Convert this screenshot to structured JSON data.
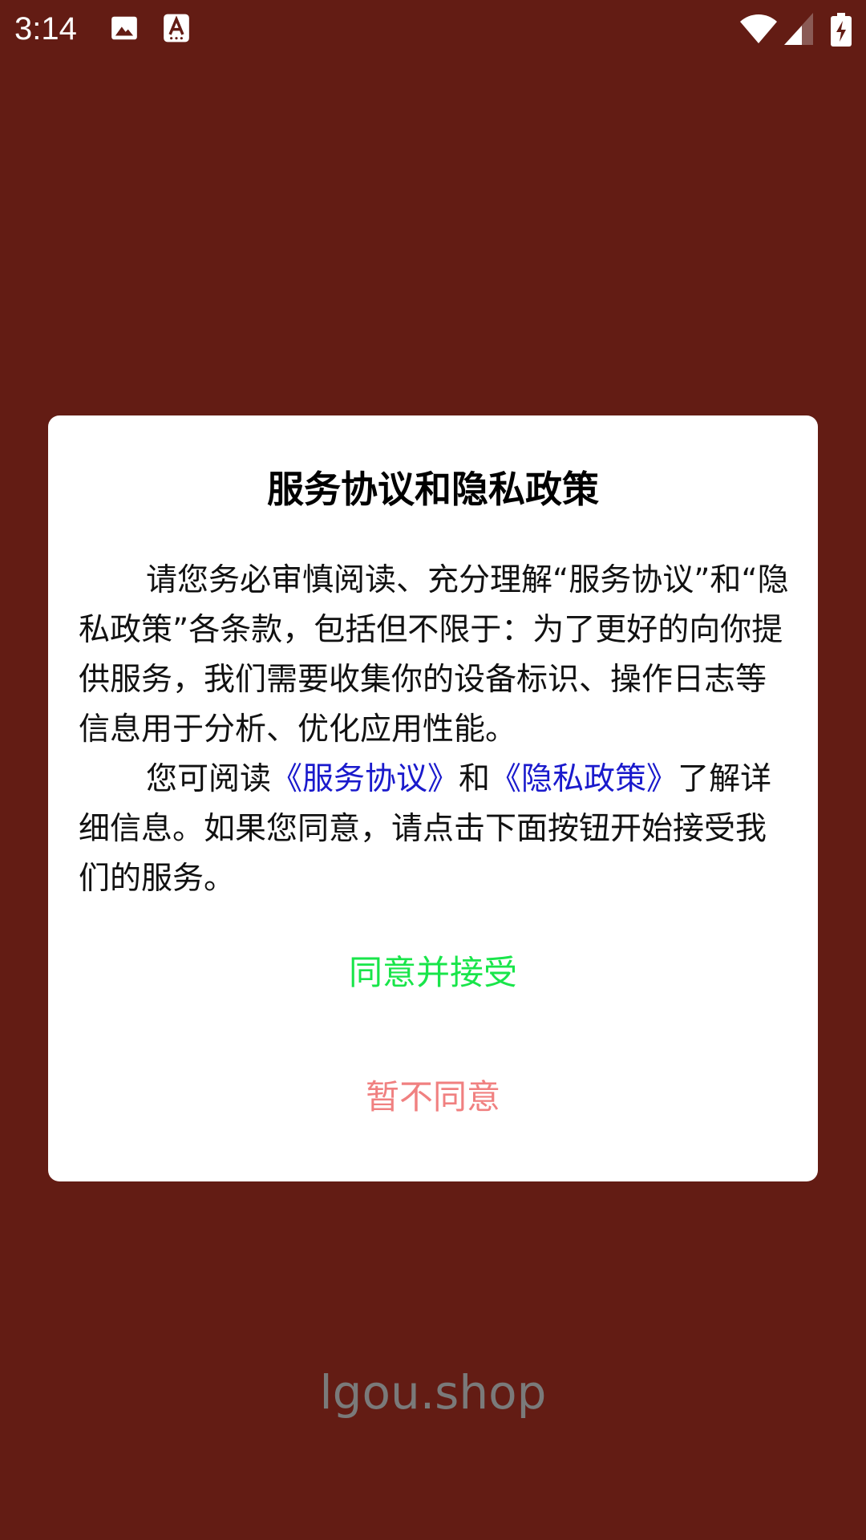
{
  "status_bar": {
    "time": "3:14",
    "icons": [
      "image-icon",
      "keyboard-icon",
      "wifi-icon",
      "signal-icon",
      "battery-charging-icon"
    ]
  },
  "dialog": {
    "title": "服务协议和隐私政策",
    "para1": "请您务必审慎阅读、充分理解“服务协议”和“隐私政策”各条款，包括但不限于：为了更好的向你提供服务，我们需要收集你的设备标识、操作日志等信息用于分析、优化应用性能。",
    "para2_prefix": "您可阅读",
    "link_service": "《服务协议》",
    "para2_and": "和",
    "link_privacy": "《隐私政策》",
    "para2_suffix": "了解详细信息。如果您同意，请点击下面按钮开始接受我们的服务。",
    "agree_label": "同意并接受",
    "decline_label": "暂不同意"
  },
  "footer": {
    "brand": "lgou.shop"
  },
  "colors": {
    "background": "#631c14",
    "link": "#1a1acc",
    "agree": "#19e54a",
    "decline": "#f08080",
    "brand": "#7a7a7a"
  }
}
